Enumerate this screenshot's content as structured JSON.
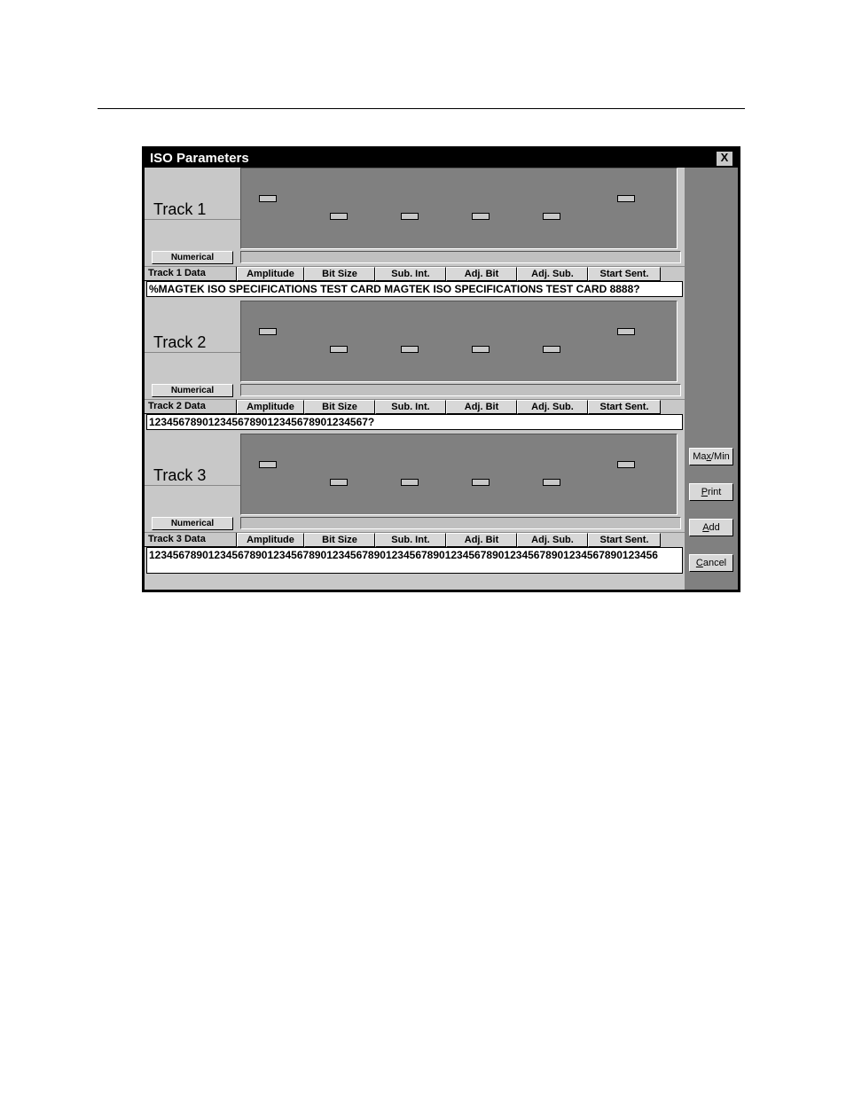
{
  "hr_top": true,
  "dialog": {
    "title": "ISO Parameters",
    "close": "X"
  },
  "columns": {
    "amplitude": "Amplitude",
    "bit_size": "Bit Size",
    "sub_int": "Sub. Int.",
    "adj_bit": "Adj. Bit",
    "adj_sub": "Adj. Sub.",
    "start_sent": "Start Sent."
  },
  "numerical_btn": "Numerical",
  "tracks": [
    {
      "title": "Track 1",
      "data_label": "Track 1 Data",
      "data": "%MAGTEK ISO SPECIFICATIONS TEST CARD MAGTEK ISO SPECIFICATIONS TEST CARD 8888?"
    },
    {
      "title": "Track 2",
      "data_label": "Track 2 Data",
      "data": "1234567890123456789012345678901234567?"
    },
    {
      "title": "Track 3",
      "data_label": "Track 3 Data",
      "data": "12345678901234567890123456789012345678901234567890123456789012345678901234567890123456"
    }
  ],
  "side_buttons": {
    "maxmin_pre": "Ma",
    "maxmin_u": "x",
    "maxmin_post": "/Min",
    "print_u": "P",
    "print_post": "rint",
    "add_u": "A",
    "add_post": "dd",
    "cancel_u": "C",
    "cancel_post": "ancel"
  }
}
